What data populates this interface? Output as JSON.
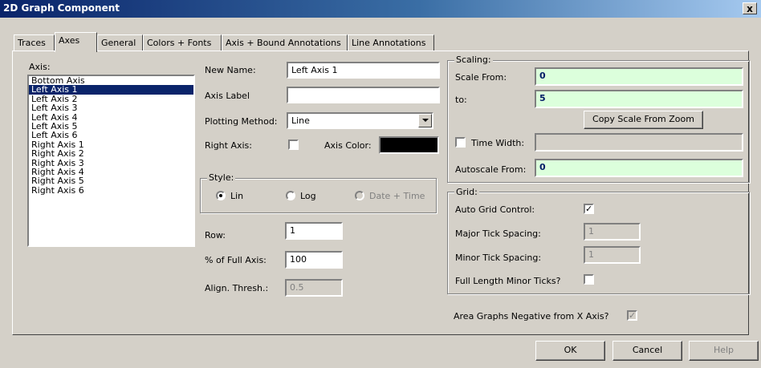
{
  "window": {
    "title": "2D Graph Component",
    "close": "x"
  },
  "tabs": [
    "Traces",
    "Axes",
    "General",
    "Colors + Fonts",
    "Axis + Bound Annotations",
    "Line Annotations"
  ],
  "axis_list": {
    "label": "Axis:",
    "items": [
      "Bottom Axis",
      "Left Axis 1",
      "Left Axis 2",
      "Left Axis 3",
      "Left Axis 4",
      "Left Axis 5",
      "Left Axis 6",
      "Right Axis 1",
      "Right Axis 2",
      "Right Axis 3",
      "Right Axis 4",
      "Right Axis 5",
      "Right Axis 6"
    ],
    "selected": "Left Axis 1"
  },
  "axis_props": {
    "new_name_label": "New Name:",
    "new_name_value": "Left Axis 1",
    "axis_label_label": "Axis Label",
    "axis_label_value": "",
    "plotting_method_label": "Plotting Method:",
    "plotting_method_value": "Line",
    "right_axis_label": "Right Axis:",
    "axis_color_label": "Axis Color:",
    "axis_color": "#000000",
    "style_title": "Style:",
    "style_lin": "Lin",
    "style_log": "Log",
    "style_date": "Date + Time",
    "row_label": "Row:",
    "row_value": "1",
    "pct_label": "% of Full Axis:",
    "pct_value": "100",
    "align_label": "Align. Thresh.:",
    "align_value": "0.5"
  },
  "scaling": {
    "title": "Scaling:",
    "scale_from_label": "Scale From:",
    "scale_from_value": "0",
    "to_label": "to:",
    "to_value": "5",
    "copy_button": "Copy Scale From Zoom",
    "time_width_label": "Time Width:",
    "time_width_value": "",
    "autoscale_label": "Autoscale From:",
    "autoscale_value": "0"
  },
  "grid": {
    "title": "Grid:",
    "auto_label": "Auto Grid Control:",
    "auto_checked": "✓",
    "major_label": "Major Tick Spacing:",
    "major_value": "1",
    "minor_label": "Minor Tick Spacing:",
    "minor_value": "1",
    "full_length_label": "Full Length Minor Ticks?"
  },
  "area_neg": {
    "label": "Area Graphs Negative from X Axis?",
    "checked": "✓"
  },
  "buttons": {
    "ok": "OK",
    "cancel": "Cancel",
    "help": "Help"
  },
  "colors": {
    "title_start": "#0a246a",
    "title_end": "#a6caf0",
    "selection": "#0a246a",
    "scale_field": "#dcffdc",
    "face": "#d4d0c8"
  }
}
